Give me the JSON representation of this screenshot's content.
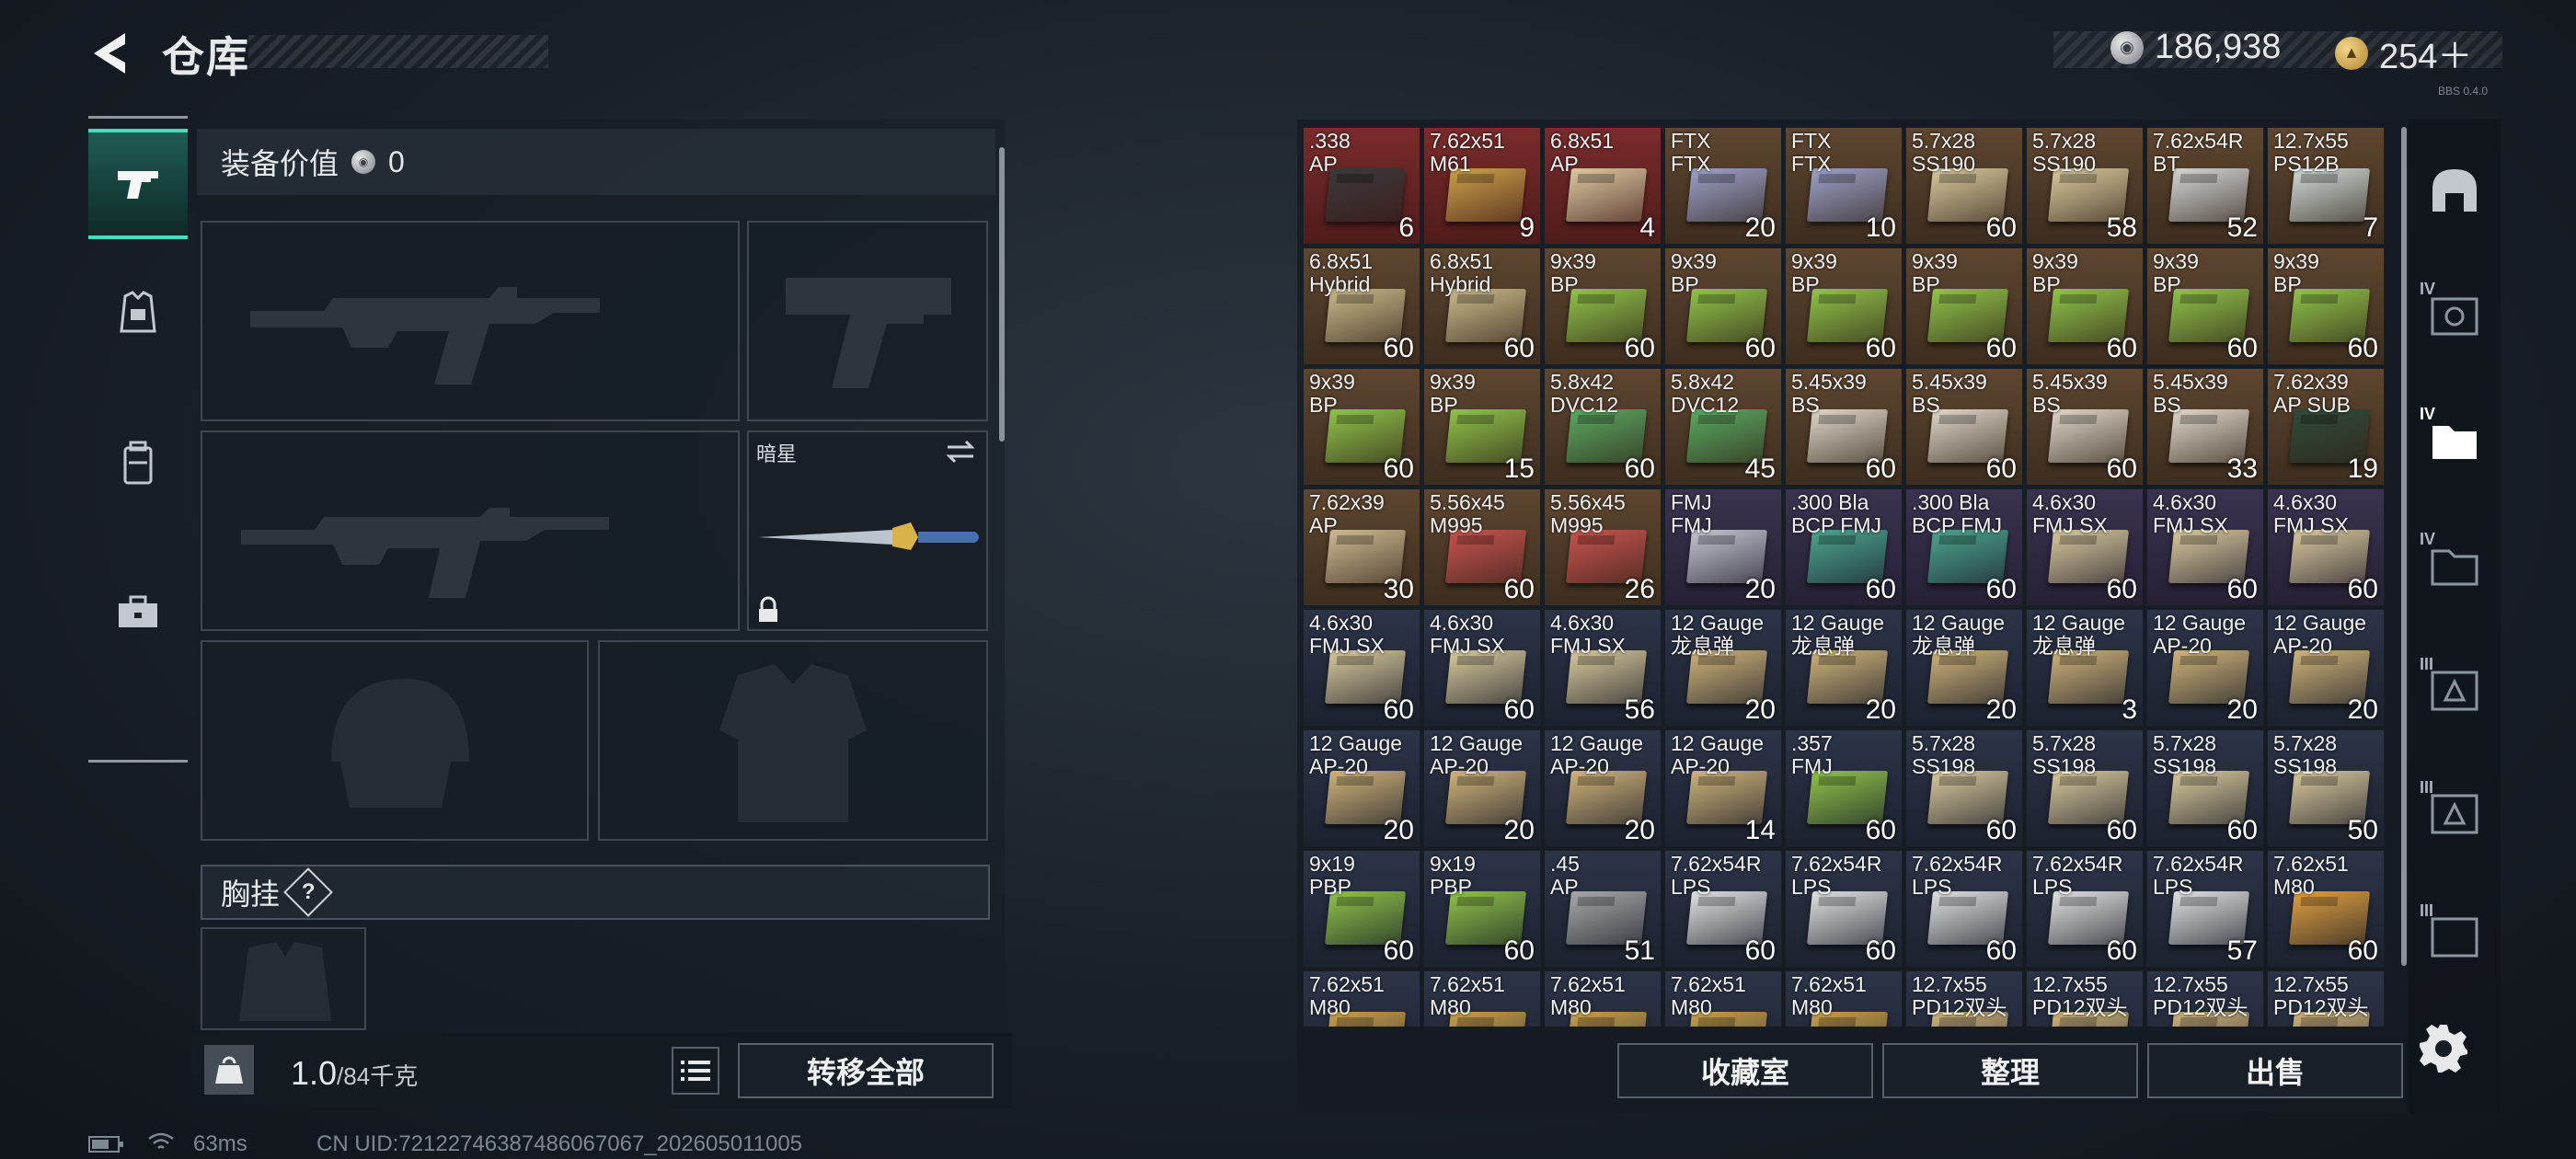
{
  "header": {
    "title": "仓库",
    "currency_silver": "186,938",
    "currency_gold": "254＋",
    "gold_plus_icon": "plus-icon",
    "version": "BBS 0.4.0"
  },
  "nav": {
    "items": [
      {
        "name": "weapons",
        "icon": "pistol-icon"
      },
      {
        "name": "armor",
        "icon": "vest-icon"
      },
      {
        "name": "backpack",
        "icon": "backpack-icon"
      },
      {
        "name": "toolbox",
        "icon": "briefcase-icon"
      }
    ]
  },
  "equipment": {
    "value_label": "装备价值",
    "value": "0",
    "melee_label": "暗星",
    "chest_label": "胸挂",
    "chest_help": "?"
  },
  "footer": {
    "weight_current": "1.0",
    "weight_max": "/84千克",
    "transfer_all": "转移全部",
    "collection": "收藏室",
    "sort": "整理",
    "sell": "出售"
  },
  "status": {
    "ping": "63ms",
    "uid": "CN UID:72122746387486067067_202605011005"
  },
  "colors": {
    "accent": "#3fe0bf",
    "tier_red": "#7a2b2b",
    "tier_brown": "#5e4630",
    "tier_blue": "#2c3448",
    "tier_purple": "#3a3350"
  },
  "inventory": {
    "rows": [
      [
        {
          "name": ".338\nAP",
          "qty": "6",
          "bg": "#7a2b2b",
          "box": "#3a3a3a"
        },
        {
          "name": "7.62x51\nM61",
          "qty": "9",
          "bg": "#7a2b2b",
          "box": "#c9a04a"
        },
        {
          "name": "6.8x51\nAP",
          "qty": "4",
          "bg": "#7a2b2b",
          "box": "#d9c9a0"
        },
        {
          "name": "FTX\nFTX",
          "qty": "20",
          "bg": "#5e4630",
          "box": "#9aa0c8"
        },
        {
          "name": "FTX\nFTX",
          "qty": "10",
          "bg": "#5e4630",
          "box": "#9aa0c8"
        },
        {
          "name": "5.7x28\nSS190",
          "qty": "60",
          "bg": "#5e4630",
          "box": "#d8c89c"
        },
        {
          "name": "5.7x28\nSS190",
          "qty": "58",
          "bg": "#5e4630",
          "box": "#d8c89c"
        },
        {
          "name": "7.62x54R\nBT",
          "qty": "52",
          "bg": "#5e4630",
          "box": "#d4d4d4"
        },
        {
          "name": "12.7x55\nPS12B",
          "qty": "7",
          "bg": "#5e4630",
          "box": "#cfd9d6"
        }
      ],
      [
        {
          "name": "6.8x51\nHybrid",
          "qty": "60",
          "bg": "#5e4630",
          "box": "#c9b88a"
        },
        {
          "name": "6.8x51\nHybrid",
          "qty": "60",
          "bg": "#5e4630",
          "box": "#c9b88a"
        },
        {
          "name": "9x39\nBP",
          "qty": "60",
          "bg": "#5e4630",
          "box": "#8fc24a"
        },
        {
          "name": "9x39\nBP",
          "qty": "60",
          "bg": "#5e4630",
          "box": "#8fc24a"
        },
        {
          "name": "9x39\nBP",
          "qty": "60",
          "bg": "#5e4630",
          "box": "#8fc24a"
        },
        {
          "name": "9x39\nBP",
          "qty": "60",
          "bg": "#5e4630",
          "box": "#8fc24a"
        },
        {
          "name": "9x39\nBP",
          "qty": "60",
          "bg": "#5e4630",
          "box": "#8fc24a"
        },
        {
          "name": "9x39\nBP",
          "qty": "60",
          "bg": "#5e4630",
          "box": "#8fc24a"
        },
        {
          "name": "9x39\nBP",
          "qty": "60",
          "bg": "#5e4630",
          "box": "#8fc24a"
        }
      ],
      [
        {
          "name": "9x39\nBP",
          "qty": "60",
          "bg": "#5e4630",
          "box": "#8fc24a"
        },
        {
          "name": "9x39\nBP",
          "qty": "15",
          "bg": "#5e4630",
          "box": "#8fc24a"
        },
        {
          "name": "5.8x42\nDVC12",
          "qty": "60",
          "bg": "#5e4630",
          "box": "#5aa860"
        },
        {
          "name": "5.8x42\nDVC12",
          "qty": "45",
          "bg": "#5e4630",
          "box": "#5aa860"
        },
        {
          "name": "5.45x39\nBS",
          "qty": "60",
          "bg": "#5e4630",
          "box": "#ddd6c8"
        },
        {
          "name": "5.45x39\nBS",
          "qty": "60",
          "bg": "#5e4630",
          "box": "#ddd6c8"
        },
        {
          "name": "5.45x39\nBS",
          "qty": "60",
          "bg": "#5e4630",
          "box": "#ddd6c8"
        },
        {
          "name": "5.45x39\nBS",
          "qty": "33",
          "bg": "#5e4630",
          "box": "#ddd6c8"
        },
        {
          "name": "7.62x39\nAP SUB",
          "qty": "19",
          "bg": "#5e4630",
          "box": "#2f4a38"
        }
      ],
      [
        {
          "name": "7.62x39\nAP",
          "qty": "30",
          "bg": "#5e4630",
          "box": "#cdb890"
        },
        {
          "name": "5.56x45\nM995",
          "qty": "60",
          "bg": "#5e4630",
          "box": "#c8524e"
        },
        {
          "name": "5.56x45\nM995",
          "qty": "26",
          "bg": "#5e4630",
          "box": "#c8524e"
        },
        {
          "name": "FMJ\nFMJ",
          "qty": "20",
          "bg": "#3a3350",
          "box": "#c4c4d0"
        },
        {
          "name": ".300 Bla\nBCP FMJ",
          "qty": "60",
          "bg": "#3a3350",
          "box": "#4aa48c"
        },
        {
          "name": ".300 Bla\nBCP FMJ",
          "qty": "60",
          "bg": "#3a3350",
          "box": "#4aa48c"
        },
        {
          "name": "4.6x30\nFMJ SX",
          "qty": "60",
          "bg": "#3a3350",
          "box": "#d8c89c"
        },
        {
          "name": "4.6x30\nFMJ SX",
          "qty": "60",
          "bg": "#3a3350",
          "box": "#d8c89c"
        },
        {
          "name": "4.6x30\nFMJ SX",
          "qty": "60",
          "bg": "#3a3350",
          "box": "#d8c89c"
        }
      ],
      [
        {
          "name": "4.6x30\nFMJ SX",
          "qty": "60",
          "bg": "#2c3448",
          "box": "#d8c89c"
        },
        {
          "name": "4.6x30\nFMJ SX",
          "qty": "60",
          "bg": "#2c3448",
          "box": "#d8c89c"
        },
        {
          "name": "4.6x30\nFMJ SX",
          "qty": "56",
          "bg": "#2c3448",
          "box": "#d8c89c"
        },
        {
          "name": "12 Gauge\n龙息弹",
          "qty": "20",
          "bg": "#2c3448",
          "box": "#cfb27a"
        },
        {
          "name": "12 Gauge\n龙息弹",
          "qty": "20",
          "bg": "#2c3448",
          "box": "#cfb27a"
        },
        {
          "name": "12 Gauge\n龙息弹",
          "qty": "20",
          "bg": "#2c3448",
          "box": "#cfb27a"
        },
        {
          "name": "12 Gauge\n龙息弹",
          "qty": "3",
          "bg": "#2c3448",
          "box": "#cfb27a"
        },
        {
          "name": "12 Gauge\nAP-20",
          "qty": "20",
          "bg": "#2c3448",
          "box": "#cfb27a"
        },
        {
          "name": "12 Gauge\nAP-20",
          "qty": "20",
          "bg": "#2c3448",
          "box": "#cfb27a"
        }
      ],
      [
        {
          "name": "12 Gauge\nAP-20",
          "qty": "20",
          "bg": "#2c3448",
          "box": "#cfb27a"
        },
        {
          "name": "12 Gauge\nAP-20",
          "qty": "20",
          "bg": "#2c3448",
          "box": "#cfb27a"
        },
        {
          "name": "12 Gauge\nAP-20",
          "qty": "20",
          "bg": "#2c3448",
          "box": "#cfb27a"
        },
        {
          "name": "12 Gauge\nAP-20",
          "qty": "14",
          "bg": "#2c3448",
          "box": "#cfb27a"
        },
        {
          "name": ".357\nFMJ",
          "qty": "60",
          "bg": "#2c3448",
          "box": "#8fc24a"
        },
        {
          "name": "5.7x28\nSS198",
          "qty": "60",
          "bg": "#2c3448",
          "box": "#d8c89c"
        },
        {
          "name": "5.7x28\nSS198",
          "qty": "60",
          "bg": "#2c3448",
          "box": "#d8c89c"
        },
        {
          "name": "5.7x28\nSS198",
          "qty": "60",
          "bg": "#2c3448",
          "box": "#d8c89c"
        },
        {
          "name": "5.7x28\nSS198",
          "qty": "50",
          "bg": "#2c3448",
          "box": "#d8c89c"
        }
      ],
      [
        {
          "name": "9x19\nPBP",
          "qty": "60",
          "bg": "#2c3448",
          "box": "#8fc24a"
        },
        {
          "name": "9x19\nPBP",
          "qty": "60",
          "bg": "#2c3448",
          "box": "#8fc24a"
        },
        {
          "name": ".45\nAP",
          "qty": "51",
          "bg": "#2c3448",
          "box": "#a8a8a8"
        },
        {
          "name": "7.62x54R\nLPS",
          "qty": "60",
          "bg": "#2c3448",
          "box": "#e0e0e0"
        },
        {
          "name": "7.62x54R\nLPS",
          "qty": "60",
          "bg": "#2c3448",
          "box": "#e0e0e0"
        },
        {
          "name": "7.62x54R\nLPS",
          "qty": "60",
          "bg": "#2c3448",
          "box": "#e0e0e0"
        },
        {
          "name": "7.62x54R\nLPS",
          "qty": "60",
          "bg": "#2c3448",
          "box": "#e0e0e0"
        },
        {
          "name": "7.62x54R\nLPS",
          "qty": "57",
          "bg": "#2c3448",
          "box": "#e0e0e0"
        },
        {
          "name": "7.62x51\nM80",
          "qty": "60",
          "bg": "#2c3448",
          "box": "#e0a040"
        }
      ],
      [
        {
          "name": "7.62x51\nM80",
          "qty": "",
          "bg": "#2c3448",
          "box": "#c9a04a"
        },
        {
          "name": "7.62x51\nM80",
          "qty": "",
          "bg": "#2c3448",
          "box": "#c9a04a"
        },
        {
          "name": "7.62x51\nM80",
          "qty": "",
          "bg": "#2c3448",
          "box": "#c9a04a"
        },
        {
          "name": "7.62x51\nM80",
          "qty": "",
          "bg": "#2c3448",
          "box": "#c9a04a"
        },
        {
          "name": "7.62x51\nM80",
          "qty": "",
          "bg": "#2c3448",
          "box": "#c9a04a"
        },
        {
          "name": "12.7x55\nPD12双头",
          "qty": "",
          "bg": "#2c3448",
          "box": "#cfb27a"
        },
        {
          "name": "12.7x55\nPD12双头",
          "qty": "",
          "bg": "#2c3448",
          "box": "#cfb27a"
        },
        {
          "name": "12.7x55\nPD12双头",
          "qty": "",
          "bg": "#2c3448",
          "box": "#cfb27a"
        },
        {
          "name": "12.7x55\nPD12双头",
          "qty": "",
          "bg": "#2c3448",
          "box": "#cfb27a"
        }
      ]
    ]
  },
  "rail": {
    "items": [
      {
        "icon": "helmet-icon",
        "tier": ""
      },
      {
        "icon": "safe-box-icon",
        "tier": "IV"
      },
      {
        "icon": "folder-icon",
        "tier": "IV"
      },
      {
        "icon": "folder-icon",
        "tier": "IV"
      },
      {
        "icon": "crate-icon",
        "tier": "III"
      },
      {
        "icon": "crate-icon",
        "tier": "III"
      },
      {
        "icon": "crate-icon",
        "tier": "III"
      }
    ]
  }
}
